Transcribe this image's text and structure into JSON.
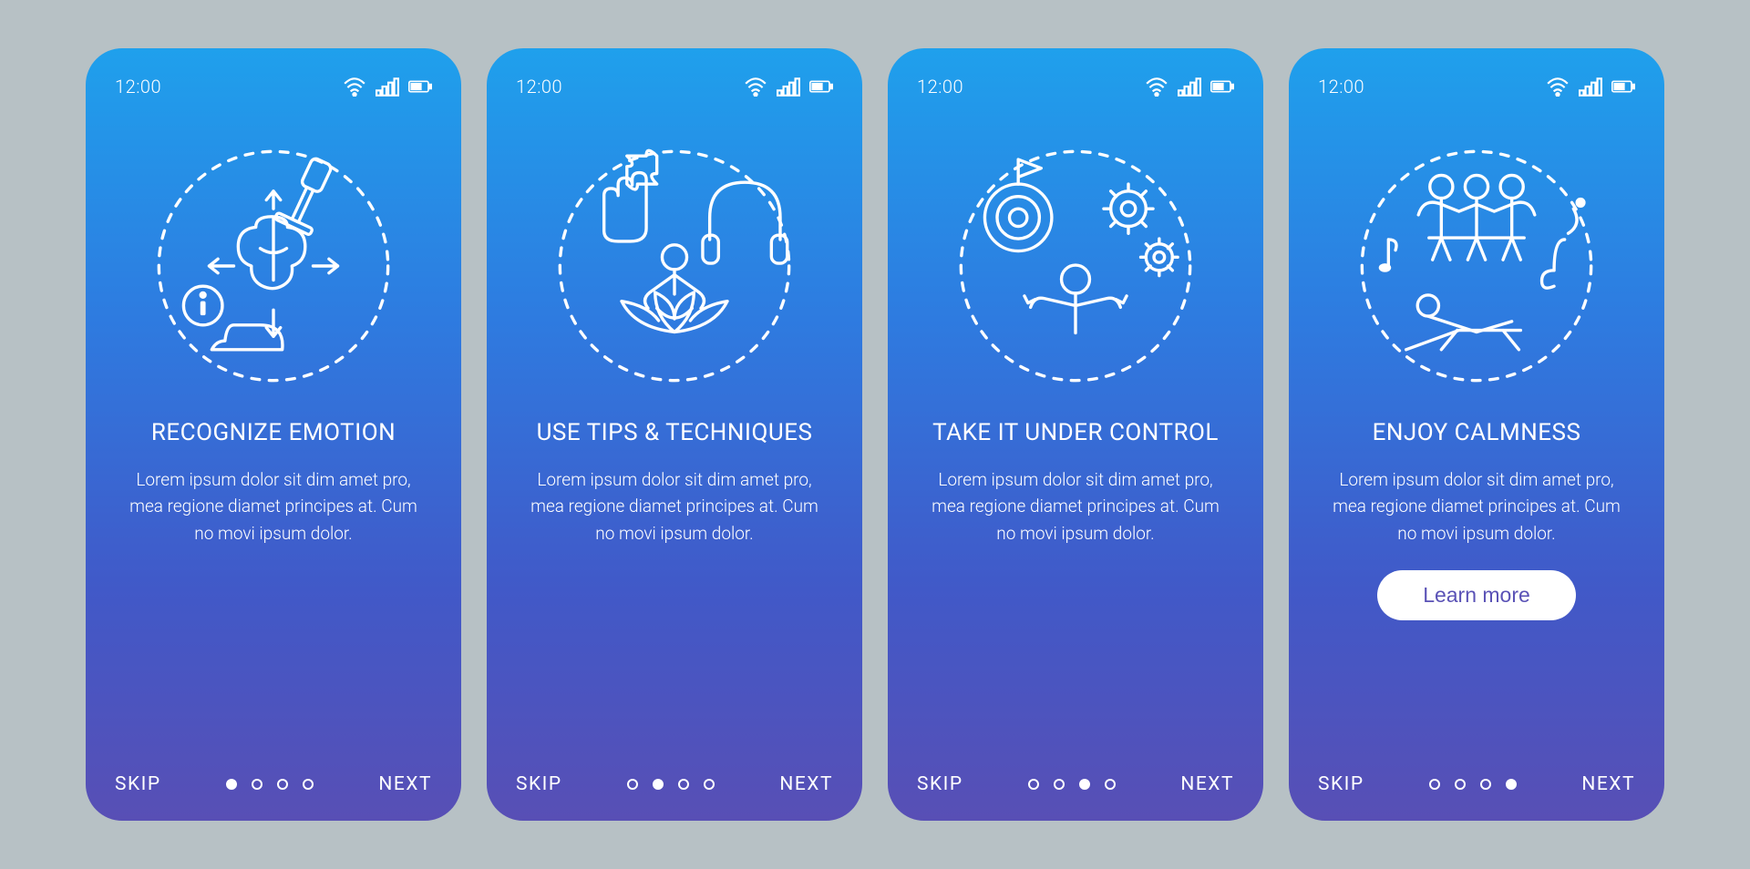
{
  "status": {
    "time": "12:00"
  },
  "nav": {
    "skip": "SKIP",
    "next": "NEXT"
  },
  "screens": [
    {
      "title": "Recognize emotion",
      "desc": "Lorem ipsum dolor sit dim amet pro, mea regione diamet principes at. Cum no movi ipsum dolor.",
      "activeDot": 0,
      "learnMore": false
    },
    {
      "title": "Use tips & techniques",
      "desc": "Lorem ipsum dolor sit dim amet pro, mea regione diamet principes at. Cum no movi ipsum dolor.",
      "activeDot": 1,
      "learnMore": false
    },
    {
      "title": "Take it under control",
      "desc": "Lorem ipsum dolor sit dim amet pro, mea regione diamet principes at. Cum no movi ipsum dolor.",
      "activeDot": 2,
      "learnMore": false
    },
    {
      "title": "Enjoy calmness",
      "desc": "Lorem ipsum dolor sit dim amet pro, mea regione diamet principes at. Cum no movi ipsum dolor.",
      "activeDot": 3,
      "learnMore": true,
      "learnMoreLabel": "Learn more"
    }
  ]
}
